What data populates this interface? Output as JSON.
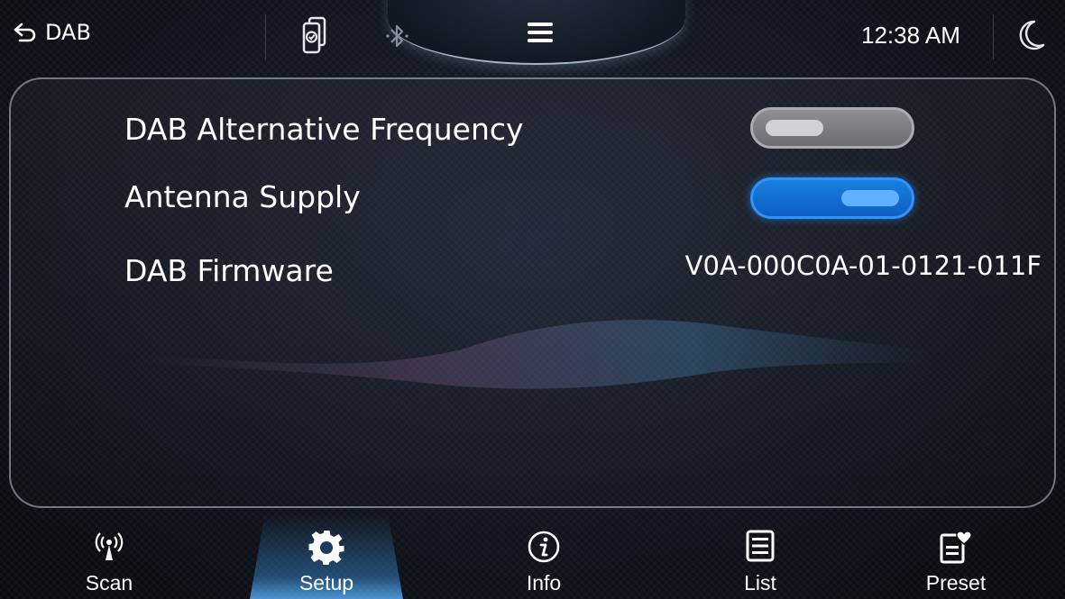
{
  "topbar": {
    "back_label": "DAB",
    "clock": "12:38 AM",
    "icons": [
      "back-arrow-icon",
      "phone-sync-icon",
      "bluetooth-icon",
      "menu-icon",
      "night-mode-icon"
    ]
  },
  "settings": {
    "rows": [
      {
        "label": "DAB Alternative Frequency",
        "control": "toggle",
        "state": "off"
      },
      {
        "label": "Antenna Supply",
        "control": "toggle",
        "state": "on"
      },
      {
        "label": "DAB Firmware",
        "value": "V0A-000C0A-01-0121-011F"
      }
    ]
  },
  "bottom_nav": {
    "tabs": [
      {
        "label": "Scan",
        "icon": "antenna-icon"
      },
      {
        "label": "Setup",
        "icon": "gear-icon",
        "active": true
      },
      {
        "label": "Info",
        "icon": "info-icon"
      },
      {
        "label": "List",
        "icon": "list-icon"
      },
      {
        "label": "Preset",
        "icon": "preset-heart-icon"
      }
    ]
  },
  "colors": {
    "accent": "#1a7fe0",
    "toggle_off": "#8d8f94",
    "background": "#0c0f16"
  }
}
